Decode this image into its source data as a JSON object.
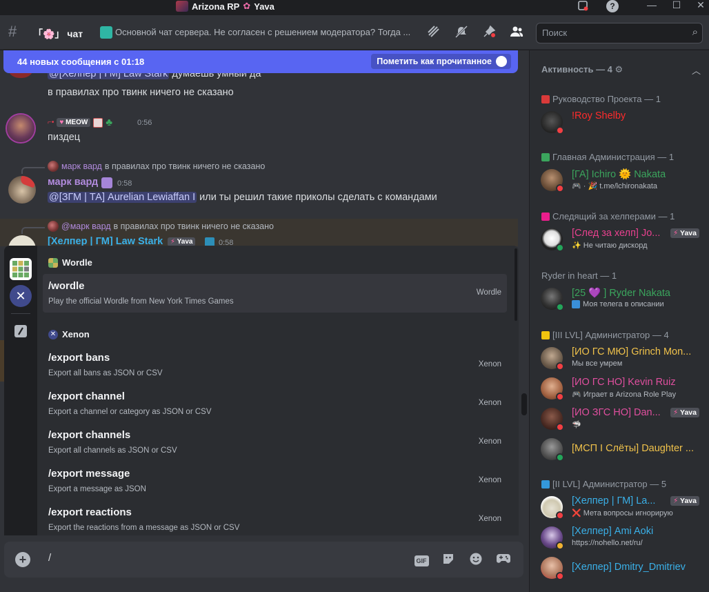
{
  "titlebar": {
    "title": "Arizona RP",
    "title_suffix": "Yava",
    "server_icon": "server-avatar"
  },
  "header": {
    "channel_prefix": "「🌸」",
    "channel_name": "чат",
    "topic": "Основной чат сервера. Не согласен с решением модератора? Тогда ...",
    "search_placeholder": "Поиск",
    "icons": [
      "threads-icon",
      "mute-icon",
      "pin-icon",
      "members-icon"
    ]
  },
  "newbar": {
    "text": "44 новых сообщения с 01:18",
    "mark_read": "Пометить как прочитанное"
  },
  "messages": [
    {
      "mention": "@[Хелпер | ГМ] Law Stark",
      "text_after": " думаешь умный да",
      "line2": "в правилах про твинк ничего не сказано"
    },
    {
      "author_tag": "MEOW",
      "time": "0:56",
      "text": "пиздец"
    },
    {
      "reply_author": "марк вард",
      "reply_text": "в правилах про твинк ничего не сказано",
      "author": "марк вард",
      "time": "0:58",
      "mention": "@[ЗГМ | ТА] Aurelian Lewiaffan I",
      "text_after": " или ты решил такие приколы сделать с командами"
    },
    {
      "reply_author": "@марк вард",
      "reply_text": "в правилах про твинк ничего не сказано",
      "author": "[Хелпер | ГМ] Law Stark",
      "tag": "Yava",
      "time": "0:58"
    }
  ],
  "autocomplete": {
    "sections": [
      {
        "name": "Wordle",
        "commands": [
          {
            "name": "/wordle",
            "desc": "Play the official Wordle from New York Times Games",
            "source": "Wordle"
          }
        ]
      },
      {
        "name": "Xenon",
        "commands": [
          {
            "name": "/export bans",
            "desc": "Export all bans as JSON or CSV",
            "source": "Xenon"
          },
          {
            "name": "/export channel",
            "desc": "Export a channel or category as JSON or CSV",
            "source": "Xenon"
          },
          {
            "name": "/export channels",
            "desc": "Export all channels as JSON or CSV",
            "source": "Xenon"
          },
          {
            "name": "/export message",
            "desc": "Export a message as JSON",
            "source": "Xenon"
          },
          {
            "name": "/export reactions",
            "desc": "Export the reactions from a message as JSON or CSV",
            "source": "Xenon"
          }
        ]
      }
    ]
  },
  "composer": {
    "value": "/",
    "gif_label": "GIF"
  },
  "members": {
    "activity": "Активность — 4",
    "groups": [
      {
        "name": "Руководство Проекта — 1",
        "color": "#e74c3c",
        "members": [
          {
            "name": "!Roy Shelby",
            "color": "#ff2b2b",
            "status": "",
            "presence": "dnd"
          }
        ]
      },
      {
        "name": "Главная Администрация — 1",
        "color": "#2ecc71",
        "members": [
          {
            "name": "[ГА] Ichiro 🌞 Nakata",
            "color": "#3ba55d",
            "status": "🎮 · 🎉 t.me/lchironakata",
            "presence": "dnd"
          }
        ]
      },
      {
        "name": "Следящий за хелперами — 1",
        "color": "#e91e8c",
        "members": [
          {
            "name": "[След за хелп] Jo...",
            "color": "#e9418f",
            "status": "✨ Не читаю дискорд",
            "presence": "online",
            "badge": "Yava"
          }
        ]
      },
      {
        "name": "Ryder in heart — 1",
        "color": "",
        "members": [
          {
            "name": "[25 💜 ] Ryder Nakata",
            "color": "#3ba55d",
            "status": "Моя телега в описании",
            "presence": "online"
          }
        ]
      },
      {
        "name": "[III LVL] Администратор — 4",
        "color": "#f1c40f",
        "members": [
          {
            "name": "[ИО ГС МЮ] Grinch Mon...",
            "color": "#f0c24b",
            "status": "Мы все умрем",
            "presence": "dnd"
          },
          {
            "name": "[ИО ГС НО] Kevin Ruiz",
            "color": "#e04f9f",
            "status": "🎮 Играет в Arizona Role Play",
            "presence": "dnd"
          },
          {
            "name": "[ИО ЗГС НО] Dan...",
            "color": "#e04f9f",
            "status": "🦈",
            "presence": "dnd",
            "badge": "Yava"
          },
          {
            "name": "[МСП I Слёты] Daughter ...",
            "color": "#f0c24b",
            "status": "",
            "presence": "online"
          }
        ]
      },
      {
        "name": "[II LVL] Администратор — 5",
        "color": "#3498db",
        "members": [
          {
            "name": "[Хелпер | ГМ] La...",
            "color": "#3ab0e8",
            "status": "❌ Мета вопросы игнорирую",
            "presence": "dnd",
            "badge": "Yava"
          },
          {
            "name": "[Хелпер] Ami Aoki",
            "color": "#3ab0e8",
            "status": "https://nohello.net/ru/",
            "presence": "idle"
          },
          {
            "name": "[Хелпер] Dmitry_Dmitriev",
            "color": "#3ab0e8",
            "status": "",
            "presence": "dnd"
          }
        ]
      }
    ]
  }
}
